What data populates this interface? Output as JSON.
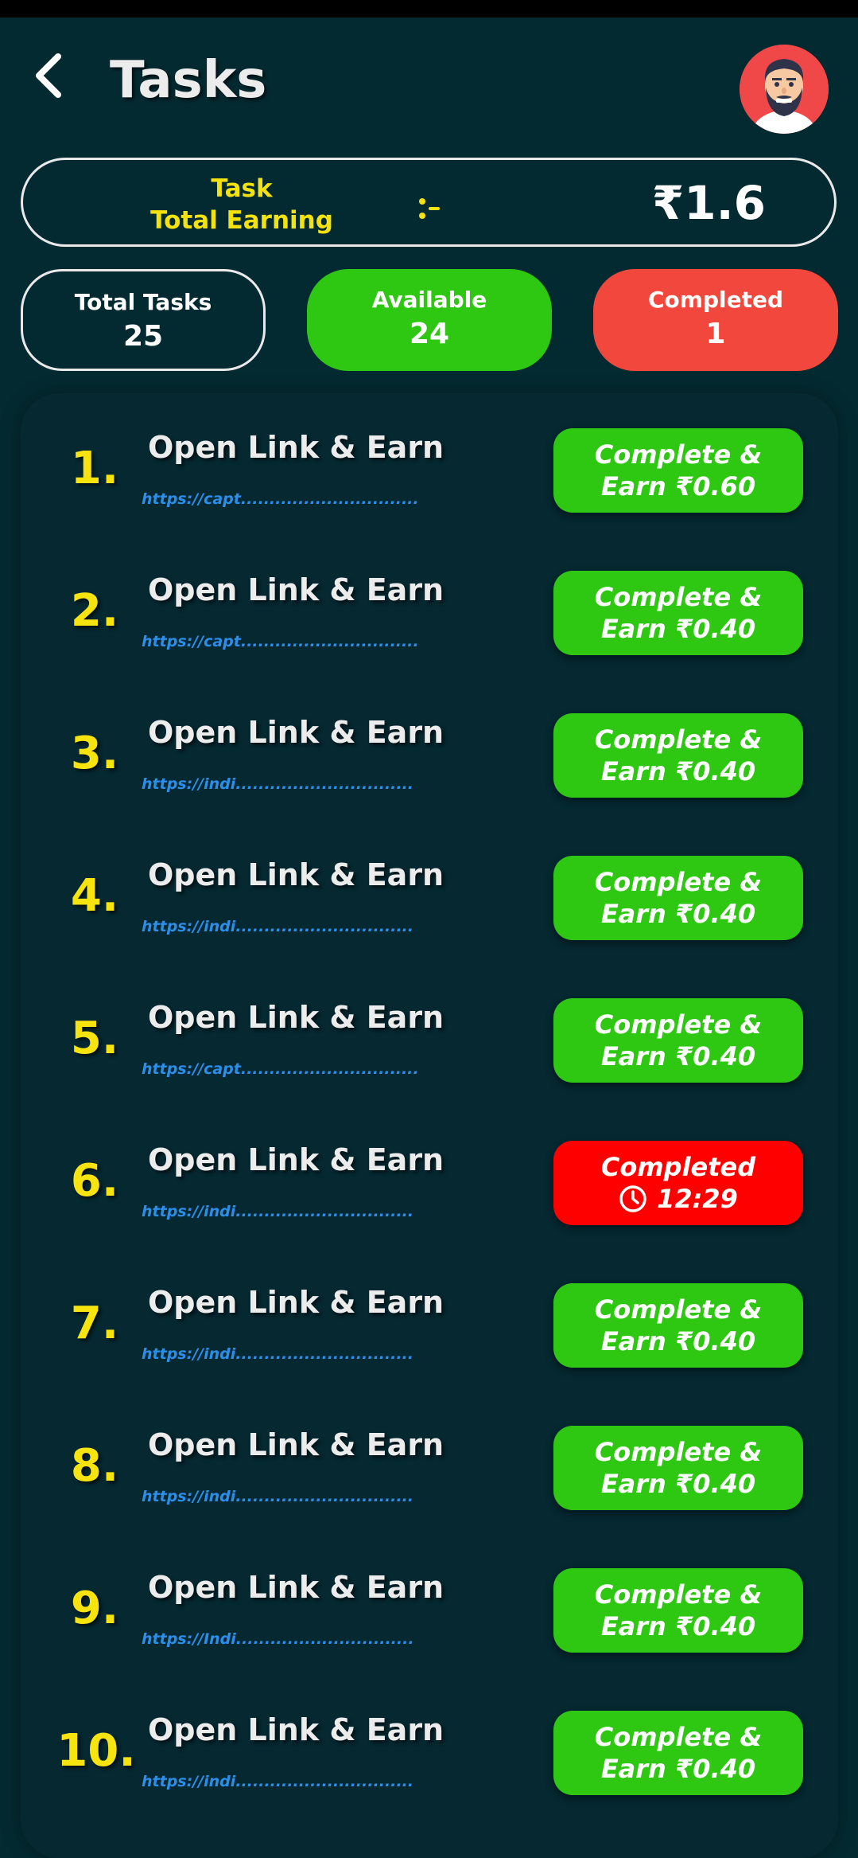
{
  "header": {
    "title": "Tasks"
  },
  "earning": {
    "label_line1": "Task",
    "label_line2": "Total Earning",
    "value": "₹1.6"
  },
  "stats": {
    "total": {
      "label": "Total Tasks",
      "value": "25"
    },
    "available": {
      "label": "Available",
      "value": "24"
    },
    "completed": {
      "label": "Completed",
      "value": "1"
    }
  },
  "tasks": [
    {
      "num": "1.",
      "name": "Open Link & Earn",
      "link": "https://capt...............................",
      "btn_line1": "Complete &",
      "btn_line2": "Earn ₹0.60",
      "status": "available"
    },
    {
      "num": "2.",
      "name": "Open Link & Earn",
      "link": "https://capt...............................",
      "btn_line1": "Complete &",
      "btn_line2": "Earn ₹0.40",
      "status": "available"
    },
    {
      "num": "3.",
      "name": "Open Link & Earn",
      "link": "https://indi...............................",
      "btn_line1": "Complete &",
      "btn_line2": "Earn ₹0.40",
      "status": "available"
    },
    {
      "num": "4.",
      "name": "Open Link & Earn",
      "link": "https://indi...............................",
      "btn_line1": "Complete &",
      "btn_line2": "Earn ₹0.40",
      "status": "available"
    },
    {
      "num": "5.",
      "name": "Open Link & Earn",
      "link": "https://capt...............................",
      "btn_line1": "Complete &",
      "btn_line2": "Earn ₹0.40",
      "status": "available"
    },
    {
      "num": "6.",
      "name": "Open Link & Earn",
      "link": "https://indi...............................",
      "btn_line1": "Completed",
      "btn_line2": "12:29",
      "status": "completed"
    },
    {
      "num": "7.",
      "name": "Open Link & Earn",
      "link": "https://indi...............................",
      "btn_line1": "Complete &",
      "btn_line2": "Earn ₹0.40",
      "status": "available"
    },
    {
      "num": "8.",
      "name": "Open Link & Earn",
      "link": "https://indi...............................",
      "btn_line1": "Complete &",
      "btn_line2": "Earn ₹0.40",
      "status": "available"
    },
    {
      "num": "9.",
      "name": "Open Link & Earn",
      "link": "https://Indi...............................",
      "btn_line1": "Complete &",
      "btn_line2": "Earn ₹0.40",
      "status": "available"
    },
    {
      "num": "10.",
      "name": "Open Link & Earn",
      "link": "https://indi...............................",
      "btn_line1": "Complete &",
      "btn_line2": "Earn ₹0.40",
      "status": "available"
    }
  ],
  "colors": {
    "background": "#042a31",
    "accent_yellow": "#f7e40f",
    "green": "#2ec712",
    "red": "#ff0000",
    "completed_stat": "#f2473d",
    "link_blue": "#2c8ee8"
  }
}
